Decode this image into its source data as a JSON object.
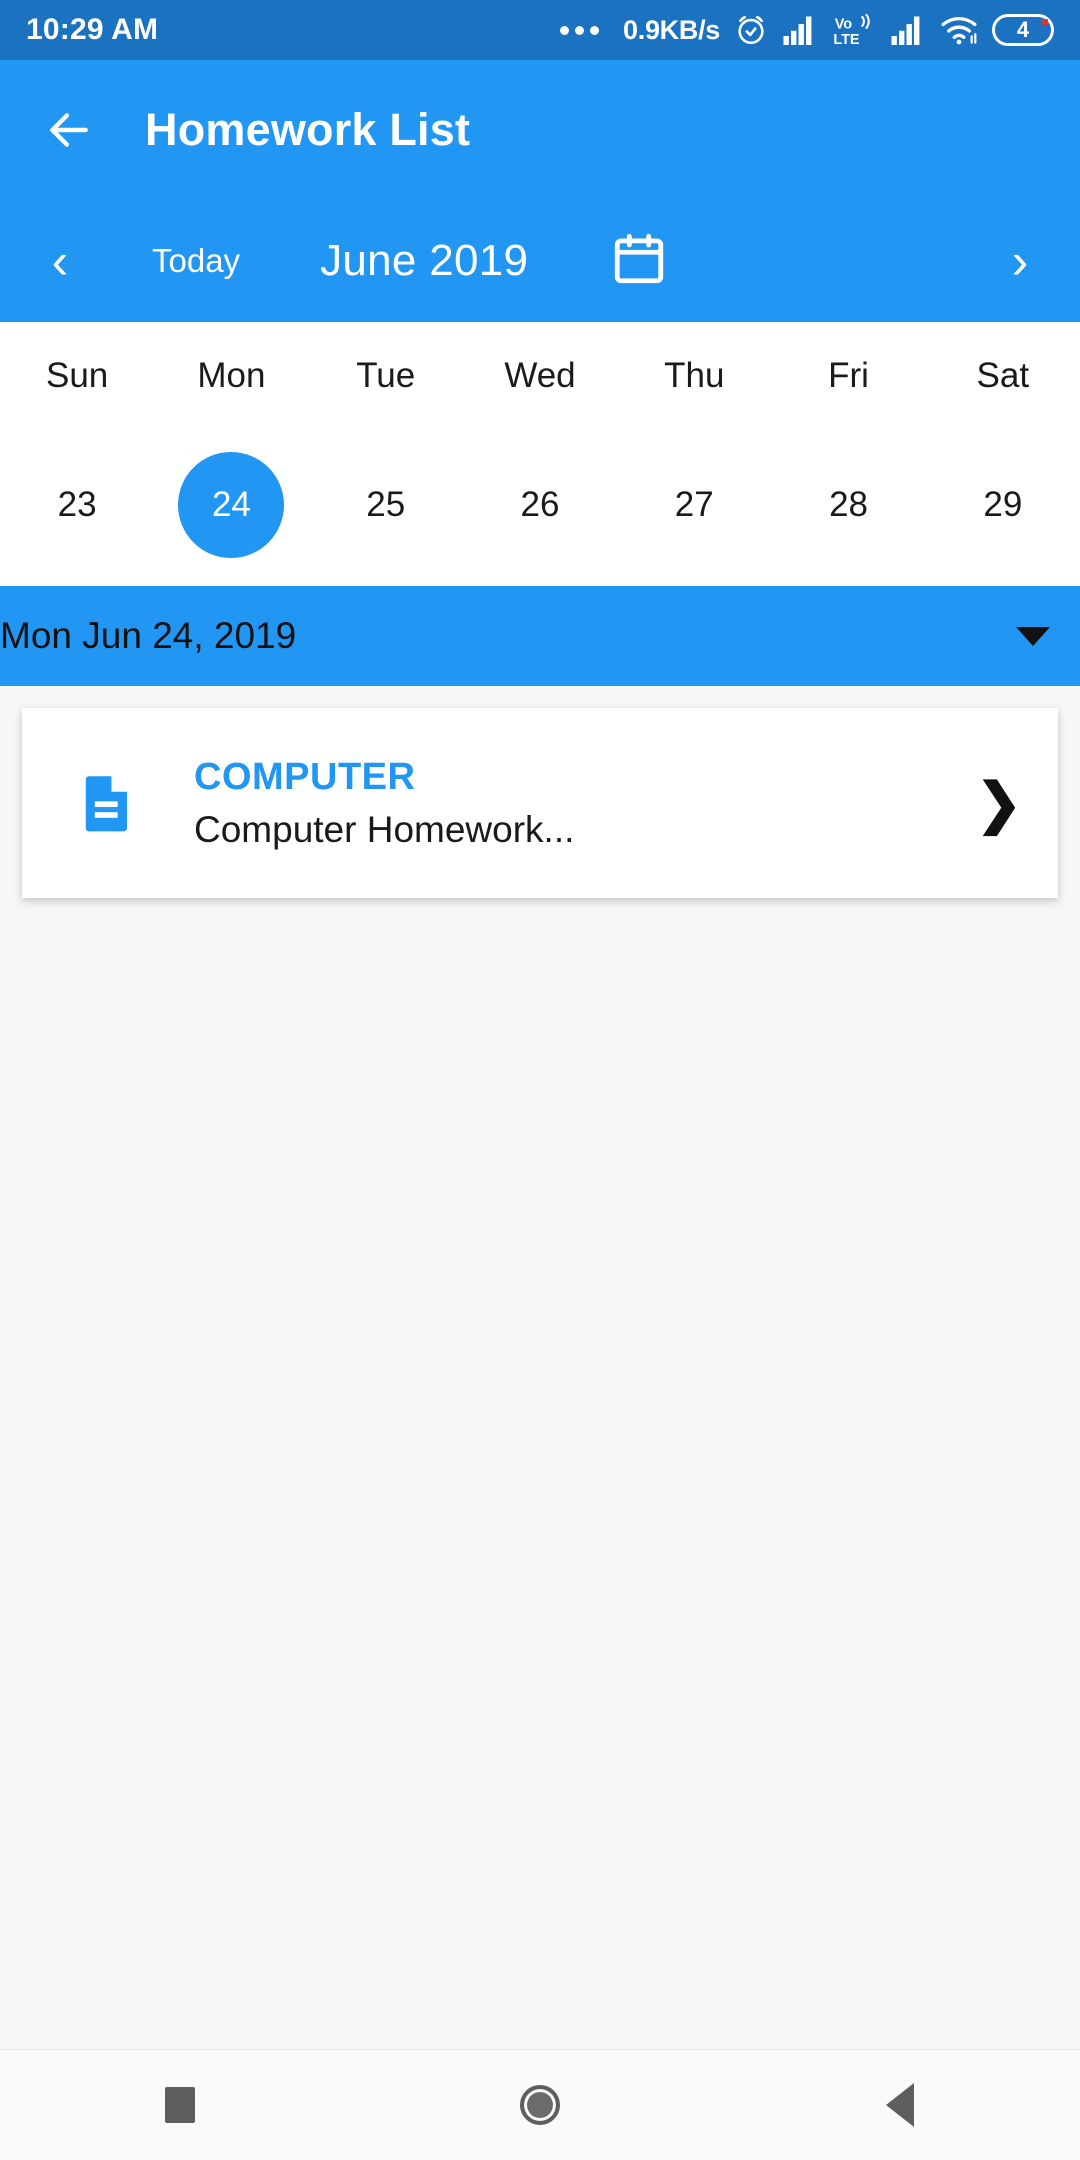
{
  "status_bar": {
    "time": "10:29 AM",
    "overflow_icon": "more-dots-icon",
    "net_speed": "0.9KB/s",
    "alarm_icon": "alarm-clock-icon",
    "signal1_icon": "cellular-signal-icon",
    "volte_top": "Vo",
    "volte_bottom": "LTE",
    "signal2_icon": "cellular-signal-icon",
    "wifi_icon": "wifi-icon",
    "battery_level": "4"
  },
  "app_bar": {
    "back_icon": "back-arrow-icon",
    "title": "Homework List"
  },
  "month_nav": {
    "prev_label": "‹",
    "today_label": "Today",
    "month_label": "June 2019",
    "calendar_icon": "calendar-icon",
    "next_label": "›"
  },
  "calendar": {
    "weekdays": [
      "Sun",
      "Mon",
      "Tue",
      "Wed",
      "Thu",
      "Fri",
      "Sat"
    ],
    "dates": [
      {
        "day": "23",
        "selected": false
      },
      {
        "day": "24",
        "selected": true
      },
      {
        "day": "25",
        "selected": false
      },
      {
        "day": "26",
        "selected": false
      },
      {
        "day": "27",
        "selected": false
      },
      {
        "day": "28",
        "selected": false
      },
      {
        "day": "29",
        "selected": false
      }
    ]
  },
  "date_selector": {
    "label": "Mon Jun 24, 2019",
    "caret_icon": "chevron-down-icon"
  },
  "homework_list": {
    "items": [
      {
        "file_icon": "document-icon",
        "subject": "COMPUTER",
        "description": "Computer Homework...",
        "chevron_icon": "chevron-right-icon",
        "chevron_label": "❯"
      }
    ]
  },
  "nav_bar": {
    "recents_icon": "recents-square-icon",
    "home_icon": "home-circle-icon",
    "back_icon": "back-triangle-icon"
  },
  "colors": {
    "status_bar": "#1B72C0",
    "app_bar": "#2196F3",
    "accent": "#2196F3",
    "page_background": "#F7F7F7",
    "card_background": "#FFFFFF",
    "text_primary": "#1A1A1A"
  }
}
